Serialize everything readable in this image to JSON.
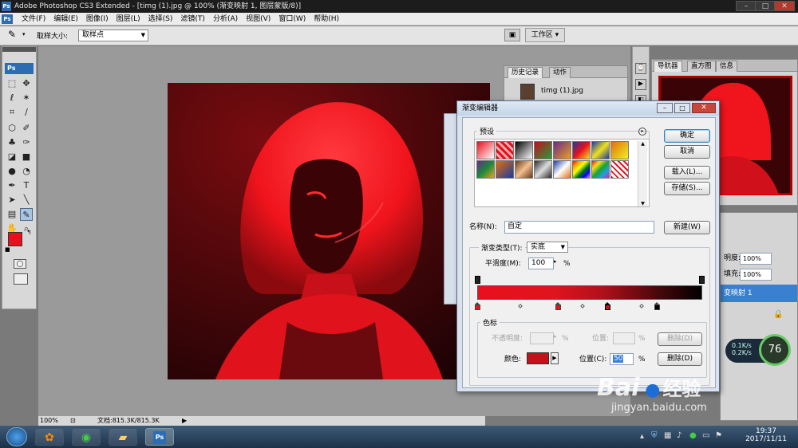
{
  "app": {
    "title": "Adobe Photoshop CS3 Extended - [timg (1).jpg @ 100% (渐变映射 1, 图层蒙版/8)]",
    "ps_logo": "Ps"
  },
  "menu": [
    "文件(F)",
    "编辑(E)",
    "图像(I)",
    "图层(L)",
    "选择(S)",
    "滤镜(T)",
    "分析(A)",
    "视图(V)",
    "窗口(W)",
    "帮助(H)"
  ],
  "options_bar": {
    "sample_size_label": "取样大小:",
    "sample_size_value": "取样点",
    "workspace_label": "工作区"
  },
  "panels": {
    "history_tab": "历史记录",
    "actions_tab": "动作",
    "history_item": "timg (1).jpg",
    "navigator_tab": "导航器",
    "histogram_tab": "直方图",
    "info_tab": "信息",
    "opacity_label": "明度:",
    "opacity_value": "100%",
    "fill_label": "填充:",
    "fill_value": "100%",
    "layer_name": "变映射 1"
  },
  "dialog": {
    "title": "渐变编辑器",
    "presets_label": "预设",
    "ok": "确定",
    "cancel": "取消",
    "load": "载入(L)...",
    "save": "存储(S)...",
    "name_label": "名称(N):",
    "name_value": "自定",
    "new_button": "新建(W)",
    "gradient_type_label": "渐变类型(T):",
    "gradient_type_value": "实底",
    "smoothness_label": "平滑度(M):",
    "smoothness_value": "100",
    "percent": "%",
    "stops_label": "色标",
    "opacity_label": "不透明度:",
    "location_label_disabled": "位置:",
    "delete_disabled": "删除(D)",
    "color_label": "颜色:",
    "location_label": "位置(C):",
    "location_value": "50",
    "delete": "删除(D)",
    "selected_color": "#c0141a"
  },
  "status": {
    "zoom": "100%",
    "doc": "文档:815.3K/815.3K"
  },
  "taskbar": {
    "time": "19:37",
    "date": "2017/11/11",
    "cpu": "76",
    "up": "0.1K/s",
    "down": "0.2K/s"
  },
  "watermark": {
    "brand": "Bai",
    "brand_cn": "经验",
    "url": "jingyan.baidu.com"
  },
  "colors": {
    "accent_red": "#e8101c",
    "foreground_color": "#e8101c"
  }
}
